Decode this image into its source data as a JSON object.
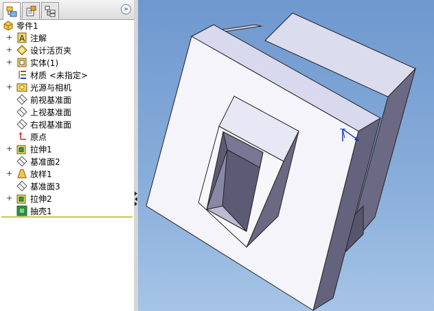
{
  "tabs": [
    {
      "name": "featuremanager-tree-icon",
      "active": true
    },
    {
      "name": "propertymanager-icon",
      "active": false
    },
    {
      "name": "configurationmanager-icon",
      "active": false
    }
  ],
  "tree": {
    "root": "零件1",
    "items": [
      {
        "label": "注解",
        "expandable": true
      },
      {
        "label": "设计活页夹",
        "expandable": true
      },
      {
        "label": "实体(1)",
        "expandable": true
      },
      {
        "label": "材质 <未指定>",
        "expandable": false
      },
      {
        "label": "光源与相机",
        "expandable": true
      },
      {
        "label": "前视基准面",
        "expandable": false
      },
      {
        "label": "上视基准面",
        "expandable": false
      },
      {
        "label": "右视基准面",
        "expandable": false
      },
      {
        "label": "原点",
        "expandable": false
      },
      {
        "label": "拉伸1",
        "expandable": true
      },
      {
        "label": "基准面2",
        "expandable": false
      },
      {
        "label": "放样1",
        "expandable": true
      },
      {
        "label": "基准面3",
        "expandable": false
      },
      {
        "label": "拉伸2",
        "expandable": true
      },
      {
        "label": "抽壳1",
        "expandable": false
      }
    ]
  },
  "colors": {
    "viewport_top": "#6f98cf",
    "viewport_bottom": "#a6c4e6",
    "rollback_bar": "#c9c94a"
  }
}
